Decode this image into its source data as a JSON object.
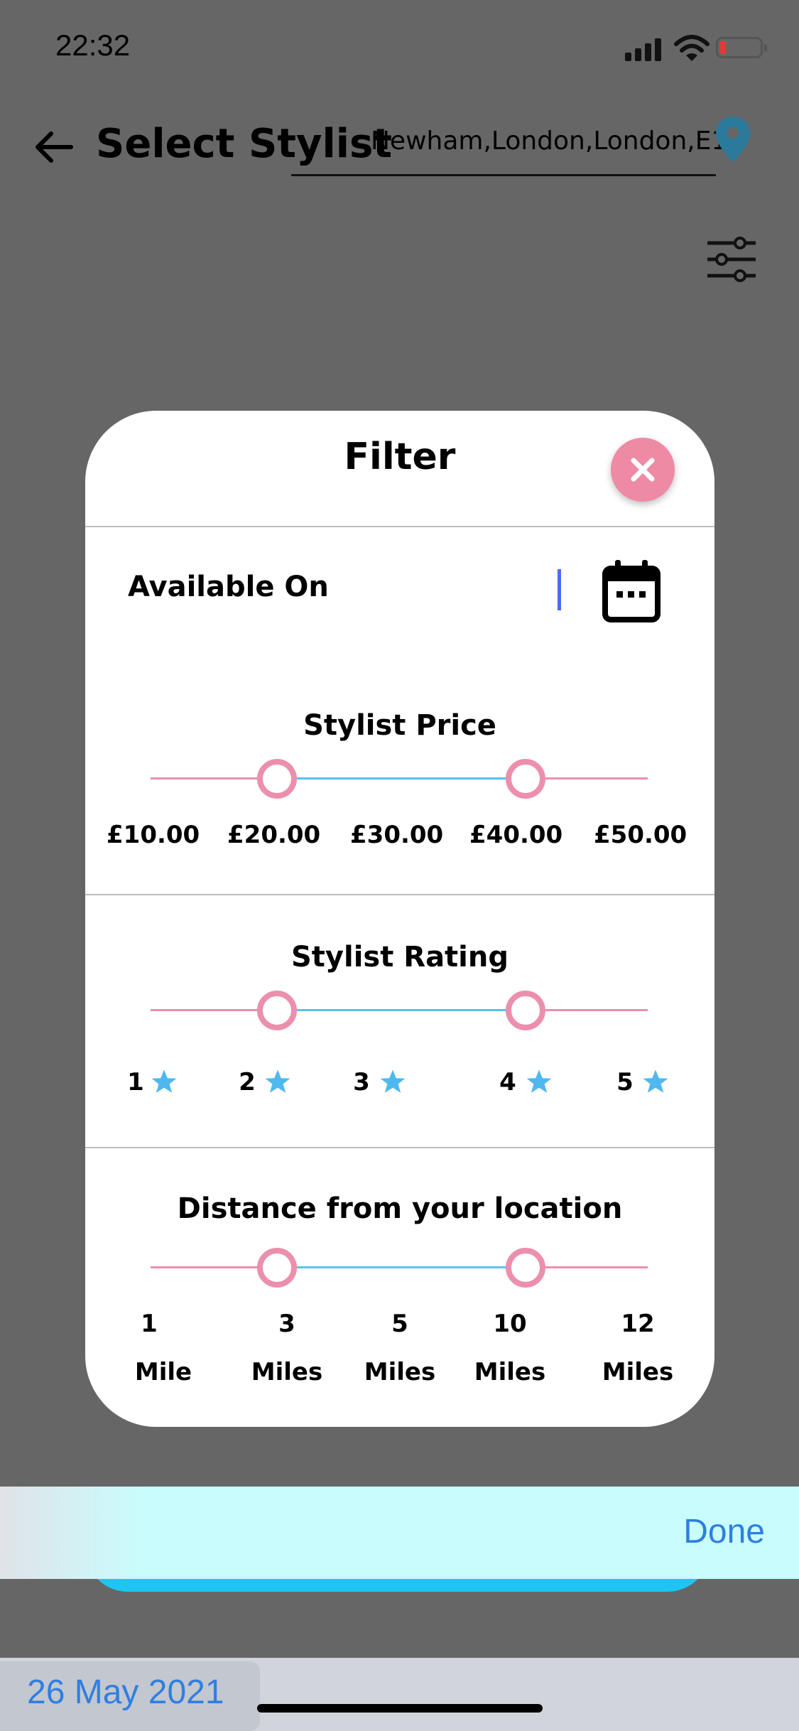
{
  "status_bar": {
    "time": "22:32"
  },
  "header": {
    "title": "Select Stylist",
    "location": "Newham,London,London,E13"
  },
  "filter": {
    "title": "Filter",
    "available_on": {
      "label": "Available On",
      "value": ""
    },
    "price": {
      "title": "Stylist Price",
      "ticks": [
        "£10.00",
        "£20.00",
        "£30.00",
        "£40.00",
        "£50.00"
      ],
      "selected_range": [
        "£20.00",
        "£40.00"
      ]
    },
    "rating": {
      "title": "Stylist Rating",
      "ticks": [
        "1",
        "2",
        "3",
        "4",
        "5"
      ],
      "selected_range": [
        2,
        4
      ]
    },
    "distance": {
      "title": "Distance from your location",
      "ticks": [
        {
          "value": "1",
          "unit": "Mile"
        },
        {
          "value": "3",
          "unit": "Miles"
        },
        {
          "value": "5",
          "unit": "Miles"
        },
        {
          "value": "10",
          "unit": "Miles"
        },
        {
          "value": "12",
          "unit": "Miles"
        }
      ],
      "selected_range": [
        "3",
        "10"
      ]
    }
  },
  "picker_toolbar": {
    "done_label": "Done"
  },
  "date_picker": {
    "selected_date": "26 May 2021"
  },
  "colors": {
    "accent_pink": "#ec8fac",
    "accent_blue": "#56c3ee",
    "star": "#4fb9ef",
    "link_blue": "#2f7fe0",
    "pin": "#2b7a9b"
  }
}
